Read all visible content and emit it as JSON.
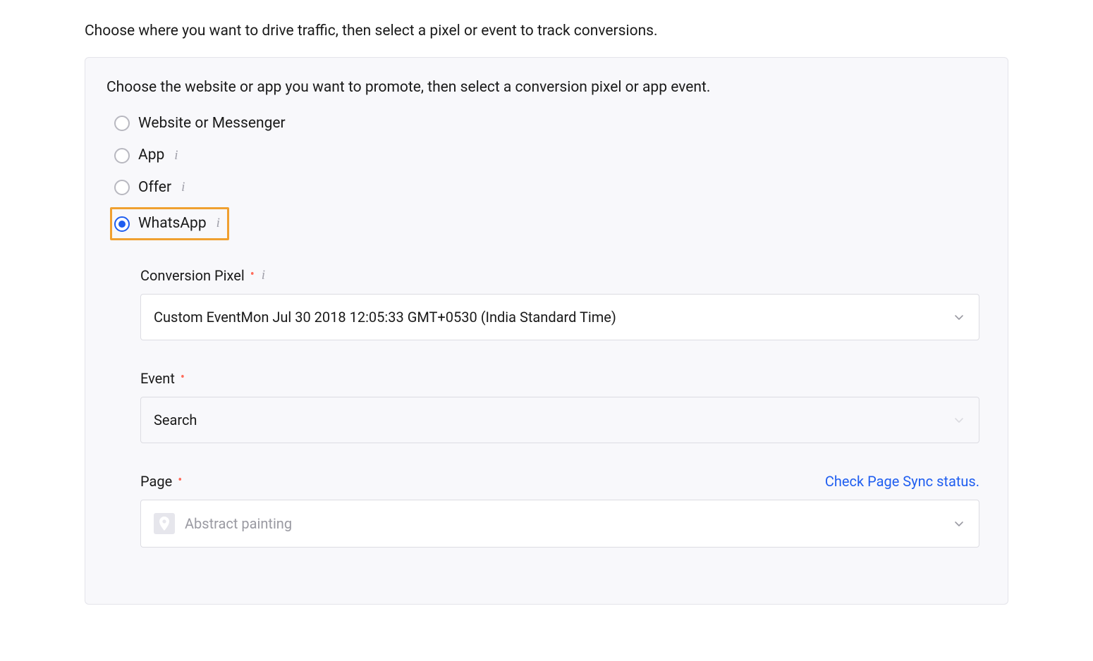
{
  "header": "Choose where you want to drive traffic, then select a pixel or event to track conversions.",
  "panel": {
    "instruction": "Choose the website or app you want to promote, then select a conversion pixel or app event.",
    "options": {
      "website": "Website or Messenger",
      "app": "App",
      "offer": "Offer",
      "whatsapp": "WhatsApp"
    }
  },
  "fields": {
    "conversion_pixel": {
      "label": "Conversion Pixel",
      "value": "Custom EventMon Jul 30 2018 12:05:33 GMT+0530 (India Standard Time)"
    },
    "event": {
      "label": "Event",
      "value": "Search"
    },
    "page": {
      "label": "Page",
      "link": "Check Page Sync status.",
      "placeholder": "Abstract painting"
    }
  }
}
